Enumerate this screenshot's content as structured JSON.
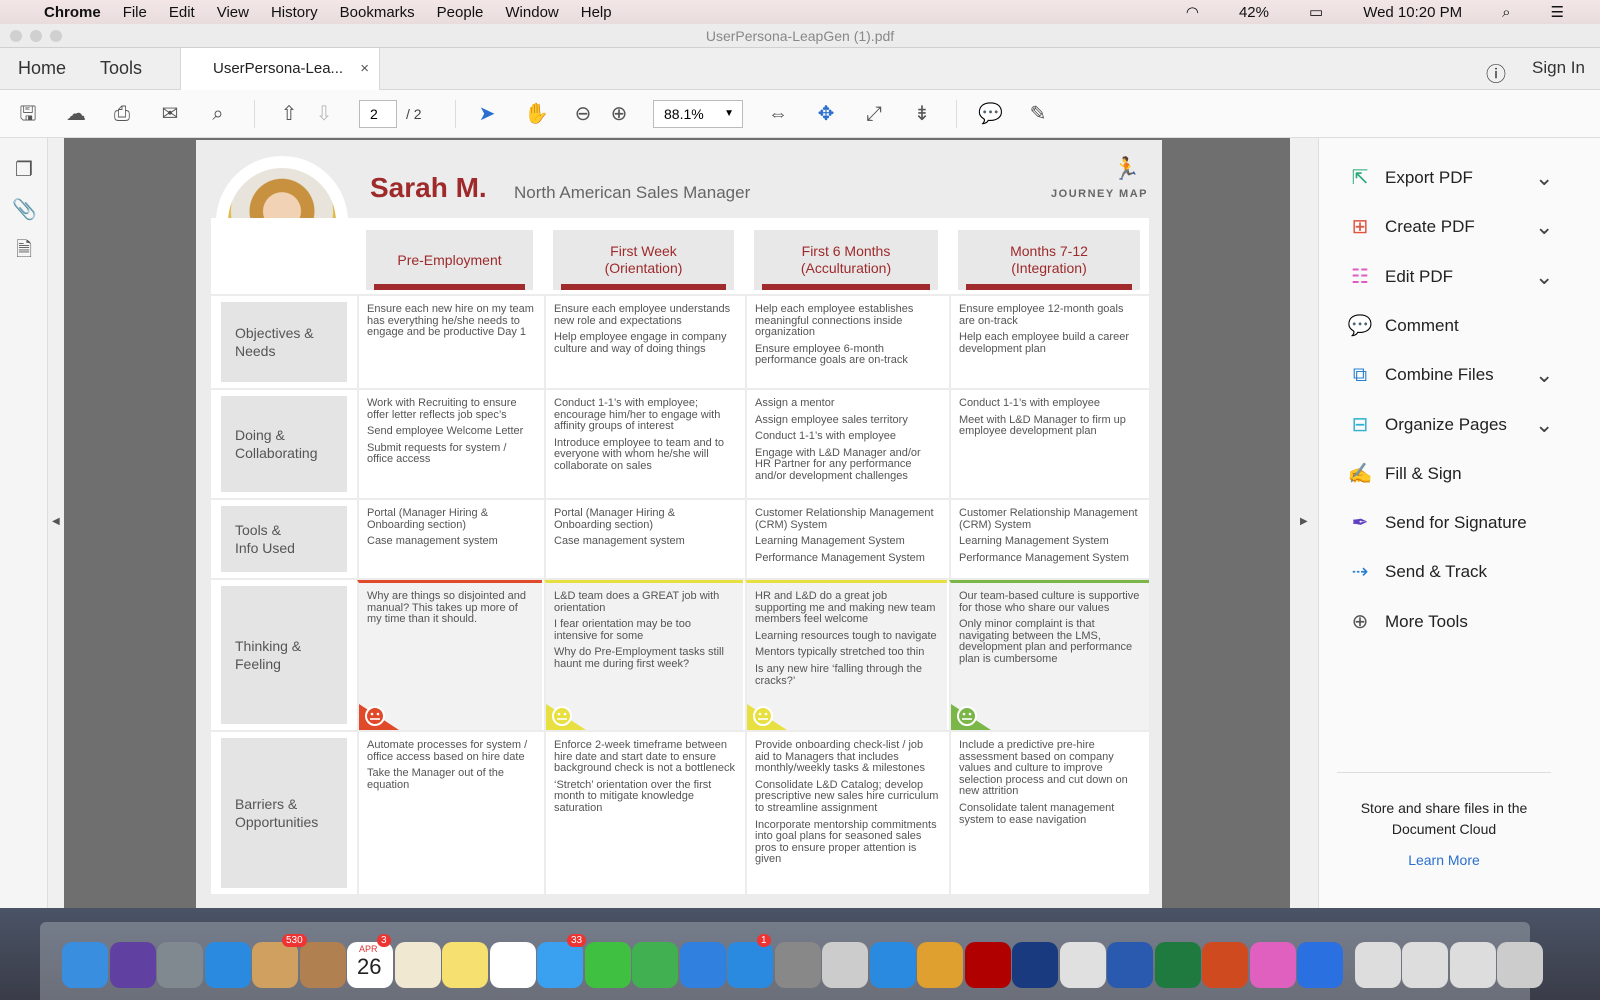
{
  "menubar": {
    "app": "Chrome",
    "items": [
      "File",
      "Edit",
      "View",
      "History",
      "Bookmarks",
      "People",
      "Window",
      "Help"
    ],
    "battery": "42%",
    "clock": "Wed 10:20 PM"
  },
  "window": {
    "title": "UserPersona-LeapGen (1).pdf"
  },
  "tabs": {
    "home": "Home",
    "tools": "Tools",
    "doc": "UserPersona-Lea...",
    "close": "×",
    "sign_in": "Sign In"
  },
  "toolbar": {
    "page_current": "2",
    "page_total": "/ 2",
    "zoom": "88.1%"
  },
  "persona": {
    "name": "Sarah M.",
    "role": "North American Sales Manager",
    "badge": "JOURNEY MAP"
  },
  "journey": {
    "phases": [
      [
        "Pre-Employment"
      ],
      [
        "First Week",
        "(Orientation)"
      ],
      [
        "First 6 Months",
        "(Acculturation)"
      ],
      [
        "Months 7-12",
        "(Integration)"
      ]
    ],
    "rows": [
      {
        "label": [
          "Objectives &",
          "Needs"
        ],
        "cells": [
          [
            "Ensure each new hire on my team has everything he/she needs to engage and be productive Day 1"
          ],
          [
            "Ensure each employee understands new role and expectations",
            "Help employee engage in company culture and way of doing things"
          ],
          [
            "Help each employee establishes meaningful connections inside organization",
            "Ensure employee 6-month performance goals are on-track"
          ],
          [
            "Ensure employee 12-month goals are on-track",
            "Help each employee build a career development plan"
          ]
        ]
      },
      {
        "label": [
          "Doing &",
          "Collaborating"
        ],
        "cells": [
          [
            "Work with Recruiting to ensure offer letter reflects job spec’s",
            "Send employee Welcome Letter",
            "Submit requests for system / office access"
          ],
          [
            "Conduct 1-1’s with employee; encourage him/her to engage with affinity groups of interest",
            "Introduce employee to team and to everyone with whom he/she will collaborate on sales"
          ],
          [
            "Assign a mentor",
            "Assign employee sales territory",
            "Conduct 1-1’s with employee",
            "Engage with L&D Manager and/or HR Partner for any performance and/or development challenges"
          ],
          [
            "Conduct 1-1’s with employee",
            "Meet with L&D Manager to firm up employee development plan"
          ]
        ]
      },
      {
        "label": [
          "Tools &",
          "Info Used"
        ],
        "cells": [
          [
            "Portal (Manager Hiring & Onboarding section)",
            "Case management system"
          ],
          [
            "Portal (Manager Hiring & Onboarding section)",
            "Case management system"
          ],
          [
            "Customer Relationship Management (CRM) System",
            "Learning Management System",
            "Performance Management System"
          ],
          [
            "Customer Relationship Management (CRM) System",
            "Learning Management System",
            "Performance Management System"
          ]
        ]
      },
      {
        "label": [
          "Thinking &",
          "Feeling"
        ],
        "cells": [
          [
            "Why are things so disjointed and manual?  This takes up more of my time than it should."
          ],
          [
            "L&D team does a GREAT job with orientation",
            "I fear orientation may be too intensive for some",
            "Why do Pre-Employment tasks still haunt me during first week?"
          ],
          [
            "HR and L&D do a great job supporting me and making new team members feel welcome",
            "Learning resources tough to navigate",
            "Mentors typically stretched too thin",
            "Is any new hire ‘falling through the cracks?’"
          ],
          [
            "Our team-based culture is supportive for those who share our values",
            "Only minor complaint is that navigating between the LMS, development plan and performance plan is cumbersome"
          ]
        ],
        "sentiment": [
          "sad",
          "neutral",
          "neutral",
          "happy"
        ],
        "colors": [
          "#e04a2a",
          "#e8e040",
          "#e8e040",
          "#7ab648"
        ]
      },
      {
        "label": [
          "Barriers &",
          "Opportunities"
        ],
        "cells": [
          [
            "Automate processes for system / office access based on hire date",
            "Take the Manager out of the equation"
          ],
          [
            "Enforce 2-week timeframe between hire date and start date to ensure background check is not a bottleneck",
            "‘Stretch’ orientation over the first month to mitigate knowledge saturation"
          ],
          [
            "Provide onboarding check-list / job aid to Managers that includes monthly/weekly tasks & milestones",
            "Consolidate L&D Catalog; develop prescriptive new sales hire curriculum to streamline assignment",
            "Incorporate mentorship commitments into goal plans for seasoned sales pros to ensure proper attention is given"
          ],
          [
            "Include a predictive pre-hire assessment based on company values and culture to improve selection process and cut down on new attrition",
            "Consolidate talent management system to ease navigation"
          ]
        ]
      }
    ]
  },
  "right_panel": {
    "tools": [
      {
        "label": "Export PDF",
        "icon": "export-pdf-icon",
        "color": "#2aa87a",
        "chev": true
      },
      {
        "label": "Create PDF",
        "icon": "create-pdf-icon",
        "color": "#e0533c",
        "chev": true
      },
      {
        "label": "Edit PDF",
        "icon": "edit-pdf-icon",
        "color": "#e05ac0",
        "chev": true
      },
      {
        "label": "Comment",
        "icon": "comment-icon",
        "color": "#f0c030",
        "chev": false
      },
      {
        "label": "Combine Files",
        "icon": "combine-files-icon",
        "color": "#2a80d0",
        "chev": true
      },
      {
        "label": "Organize Pages",
        "icon": "organize-pages-icon",
        "color": "#30b0d0",
        "chev": true
      },
      {
        "label": "Fill & Sign",
        "icon": "fill-sign-icon",
        "color": "#8060d0",
        "chev": false
      },
      {
        "label": "Send for Signature",
        "icon": "send-signature-icon",
        "color": "#6040c0",
        "chev": false
      },
      {
        "label": "Send & Track",
        "icon": "send-track-icon",
        "color": "#2a80d0",
        "chev": false
      },
      {
        "label": "More Tools",
        "icon": "more-tools-icon",
        "color": "#555555",
        "chev": false
      }
    ],
    "cloud_text": "Store and share files in the Document Cloud",
    "learn_more": "Learn More"
  },
  "dock": {
    "badges": {
      "mail": "530",
      "calendar": "3",
      "messages": "33",
      "appstore": "1"
    },
    "calendar_month": "APR",
    "calendar_day": "26"
  }
}
